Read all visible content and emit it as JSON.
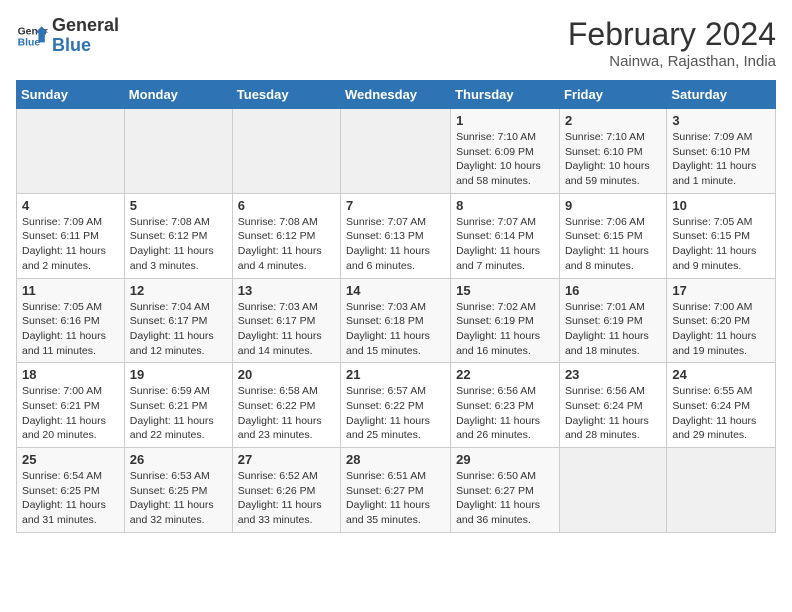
{
  "header": {
    "logo_general": "General",
    "logo_blue": "Blue",
    "month_title": "February 2024",
    "subtitle": "Nainwa, Rajasthan, India"
  },
  "weekdays": [
    "Sunday",
    "Monday",
    "Tuesday",
    "Wednesday",
    "Thursday",
    "Friday",
    "Saturday"
  ],
  "weeks": [
    [
      {
        "day": "",
        "info": ""
      },
      {
        "day": "",
        "info": ""
      },
      {
        "day": "",
        "info": ""
      },
      {
        "day": "",
        "info": ""
      },
      {
        "day": "1",
        "info": "Sunrise: 7:10 AM\nSunset: 6:09 PM\nDaylight: 10 hours\nand 58 minutes."
      },
      {
        "day": "2",
        "info": "Sunrise: 7:10 AM\nSunset: 6:10 PM\nDaylight: 10 hours\nand 59 minutes."
      },
      {
        "day": "3",
        "info": "Sunrise: 7:09 AM\nSunset: 6:10 PM\nDaylight: 11 hours\nand 1 minute."
      }
    ],
    [
      {
        "day": "4",
        "info": "Sunrise: 7:09 AM\nSunset: 6:11 PM\nDaylight: 11 hours\nand 2 minutes."
      },
      {
        "day": "5",
        "info": "Sunrise: 7:08 AM\nSunset: 6:12 PM\nDaylight: 11 hours\nand 3 minutes."
      },
      {
        "day": "6",
        "info": "Sunrise: 7:08 AM\nSunset: 6:12 PM\nDaylight: 11 hours\nand 4 minutes."
      },
      {
        "day": "7",
        "info": "Sunrise: 7:07 AM\nSunset: 6:13 PM\nDaylight: 11 hours\nand 6 minutes."
      },
      {
        "day": "8",
        "info": "Sunrise: 7:07 AM\nSunset: 6:14 PM\nDaylight: 11 hours\nand 7 minutes."
      },
      {
        "day": "9",
        "info": "Sunrise: 7:06 AM\nSunset: 6:15 PM\nDaylight: 11 hours\nand 8 minutes."
      },
      {
        "day": "10",
        "info": "Sunrise: 7:05 AM\nSunset: 6:15 PM\nDaylight: 11 hours\nand 9 minutes."
      }
    ],
    [
      {
        "day": "11",
        "info": "Sunrise: 7:05 AM\nSunset: 6:16 PM\nDaylight: 11 hours\nand 11 minutes."
      },
      {
        "day": "12",
        "info": "Sunrise: 7:04 AM\nSunset: 6:17 PM\nDaylight: 11 hours\nand 12 minutes."
      },
      {
        "day": "13",
        "info": "Sunrise: 7:03 AM\nSunset: 6:17 PM\nDaylight: 11 hours\nand 14 minutes."
      },
      {
        "day": "14",
        "info": "Sunrise: 7:03 AM\nSunset: 6:18 PM\nDaylight: 11 hours\nand 15 minutes."
      },
      {
        "day": "15",
        "info": "Sunrise: 7:02 AM\nSunset: 6:19 PM\nDaylight: 11 hours\nand 16 minutes."
      },
      {
        "day": "16",
        "info": "Sunrise: 7:01 AM\nSunset: 6:19 PM\nDaylight: 11 hours\nand 18 minutes."
      },
      {
        "day": "17",
        "info": "Sunrise: 7:00 AM\nSunset: 6:20 PM\nDaylight: 11 hours\nand 19 minutes."
      }
    ],
    [
      {
        "day": "18",
        "info": "Sunrise: 7:00 AM\nSunset: 6:21 PM\nDaylight: 11 hours\nand 20 minutes."
      },
      {
        "day": "19",
        "info": "Sunrise: 6:59 AM\nSunset: 6:21 PM\nDaylight: 11 hours\nand 22 minutes."
      },
      {
        "day": "20",
        "info": "Sunrise: 6:58 AM\nSunset: 6:22 PM\nDaylight: 11 hours\nand 23 minutes."
      },
      {
        "day": "21",
        "info": "Sunrise: 6:57 AM\nSunset: 6:22 PM\nDaylight: 11 hours\nand 25 minutes."
      },
      {
        "day": "22",
        "info": "Sunrise: 6:56 AM\nSunset: 6:23 PM\nDaylight: 11 hours\nand 26 minutes."
      },
      {
        "day": "23",
        "info": "Sunrise: 6:56 AM\nSunset: 6:24 PM\nDaylight: 11 hours\nand 28 minutes."
      },
      {
        "day": "24",
        "info": "Sunrise: 6:55 AM\nSunset: 6:24 PM\nDaylight: 11 hours\nand 29 minutes."
      }
    ],
    [
      {
        "day": "25",
        "info": "Sunrise: 6:54 AM\nSunset: 6:25 PM\nDaylight: 11 hours\nand 31 minutes."
      },
      {
        "day": "26",
        "info": "Sunrise: 6:53 AM\nSunset: 6:25 PM\nDaylight: 11 hours\nand 32 minutes."
      },
      {
        "day": "27",
        "info": "Sunrise: 6:52 AM\nSunset: 6:26 PM\nDaylight: 11 hours\nand 33 minutes."
      },
      {
        "day": "28",
        "info": "Sunrise: 6:51 AM\nSunset: 6:27 PM\nDaylight: 11 hours\nand 35 minutes."
      },
      {
        "day": "29",
        "info": "Sunrise: 6:50 AM\nSunset: 6:27 PM\nDaylight: 11 hours\nand 36 minutes."
      },
      {
        "day": "",
        "info": ""
      },
      {
        "day": "",
        "info": ""
      }
    ]
  ]
}
